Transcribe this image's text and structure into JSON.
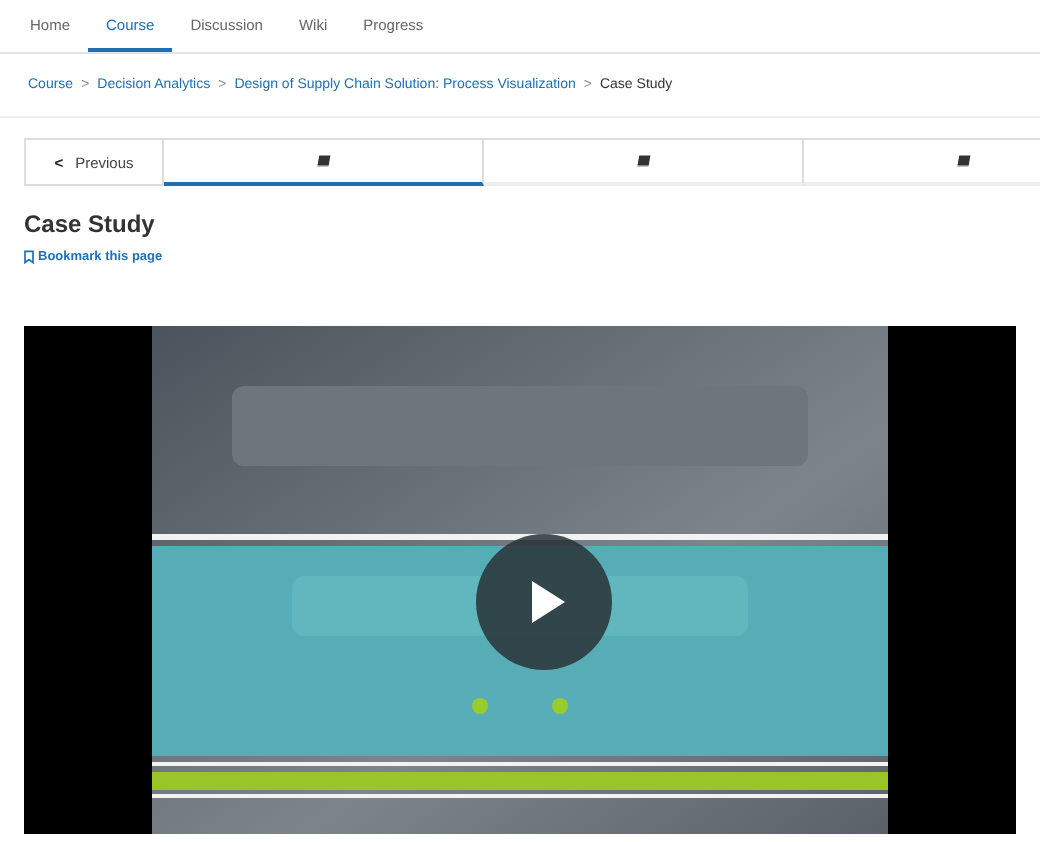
{
  "nav_tabs": [
    {
      "label": "Home",
      "selected": false
    },
    {
      "label": "Course",
      "selected": true
    },
    {
      "label": "Discussion",
      "selected": false
    },
    {
      "label": "Wiki",
      "selected": false
    },
    {
      "label": "Progress",
      "selected": false
    }
  ],
  "breadcrumb": {
    "links": [
      "Course",
      "Decision Analytics",
      "Design of Supply Chain Solution: Process Visualization"
    ],
    "separator": ">",
    "current": "Case Study"
  },
  "sequence": {
    "previous": {
      "label": "Previous",
      "icon": "<"
    },
    "units": [
      {
        "selected": true
      },
      {
        "selected": false
      },
      {
        "selected": false
      }
    ]
  },
  "unit": {
    "title": "Case Study",
    "bookmark": "Bookmark this page"
  }
}
